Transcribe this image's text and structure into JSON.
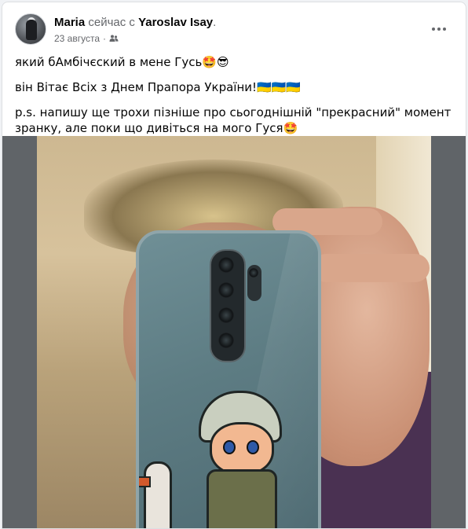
{
  "post": {
    "author": "Maria",
    "connector": "сейчас с",
    "tagged": "Yaroslav Isay",
    "tagged_suffix": ".",
    "date": "23 августа",
    "audience_icon": "friends-icon",
    "lines": [
      "який бАмбічєский в мене Гусь🤩😎",
      "він Вітає Всіх з Днем Прапора України!🇺🇦🇺🇦🇺🇦",
      "p.s. напишу ще трохи пізніше про сьогоднішній \"прекрасний\" момент зранку, але поки що дивіться на мого Гуся🤩"
    ]
  },
  "colors": {
    "background": "#f0f2f5",
    "card": "#ffffff",
    "name_text": "#050505",
    "secondary_text": "#65676b",
    "photo_frame": "#606468"
  }
}
